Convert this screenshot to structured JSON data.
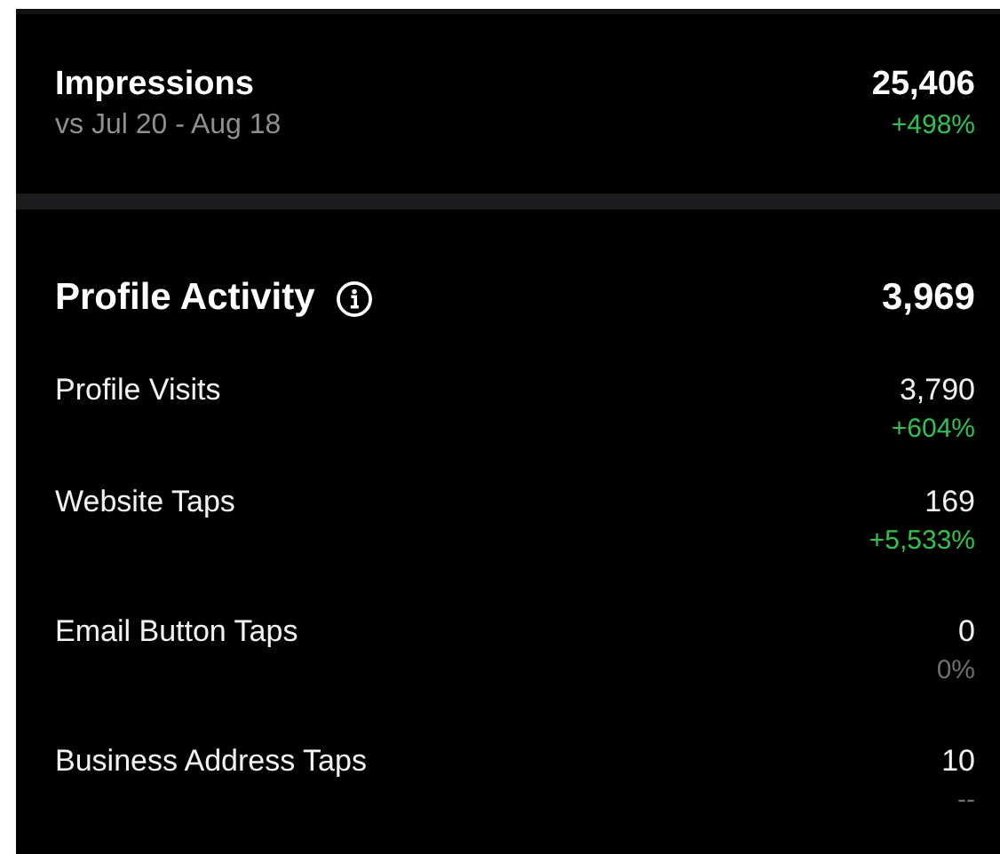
{
  "impressions": {
    "title": "Impressions",
    "subtitle": "vs Jul 20 - Aug 18",
    "value": "25,406",
    "change": "+498%",
    "color": "#30c24f"
  },
  "profile_activity": {
    "title": "Profile Activity",
    "value": "3,969",
    "rows": [
      {
        "label": "Profile Visits",
        "value": "3,790",
        "change": "+604%",
        "color": "#30c24f"
      },
      {
        "label": "Website Taps",
        "value": "169",
        "change": "+5,533%",
        "color": "#30c24f"
      },
      {
        "label": "Email Button Taps",
        "value": "0",
        "change": "0%",
        "color": "#6e6e73"
      },
      {
        "label": "Business Address Taps",
        "value": "10",
        "change": "--",
        "color": "#6e6e73"
      }
    ]
  }
}
